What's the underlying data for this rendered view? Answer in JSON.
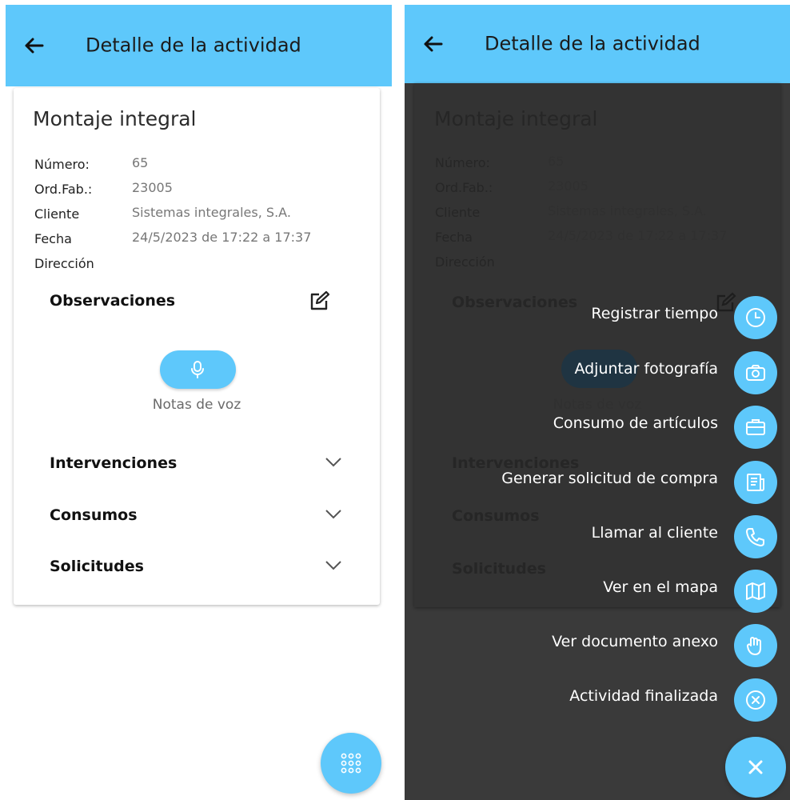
{
  "appbar": {
    "title": "Detalle de la actividad"
  },
  "activity": {
    "title": "Montaje integral",
    "fields": [
      {
        "label": "Número:",
        "value": "65"
      },
      {
        "label": "Ord.Fab.:",
        "value": "23005"
      },
      {
        "label": "Cliente",
        "value": "Sistemas integrales, S.A."
      },
      {
        "label": "Fecha",
        "value": "24/5/2023 de 17:22 a 17:37"
      },
      {
        "label": "Dirección",
        "value": ""
      }
    ],
    "observaciones": "Observaciones",
    "voice_notes": "Notas de voz",
    "sections": [
      "Intervenciones",
      "Consumos",
      "Solicitudes"
    ]
  },
  "menu": {
    "items": [
      {
        "label": "Registrar tiempo",
        "icon": "clock-icon"
      },
      {
        "label": "Adjuntar fotografía",
        "icon": "camera-icon"
      },
      {
        "label": "Consumo de artículos",
        "icon": "briefcase-icon"
      },
      {
        "label": "Generar solicitud de compra",
        "icon": "newspaper-icon"
      },
      {
        "label": "Llamar al cliente",
        "icon": "phone-icon"
      },
      {
        "label": "Ver en el mapa",
        "icon": "map-icon"
      },
      {
        "label": "Ver documento anexo",
        "icon": "hand-icon"
      },
      {
        "label": "Actividad finalizada",
        "icon": "close-circle-icon"
      }
    ]
  },
  "colors": {
    "primary": "#5ec8fb",
    "overlay": "#3a3a3a"
  }
}
